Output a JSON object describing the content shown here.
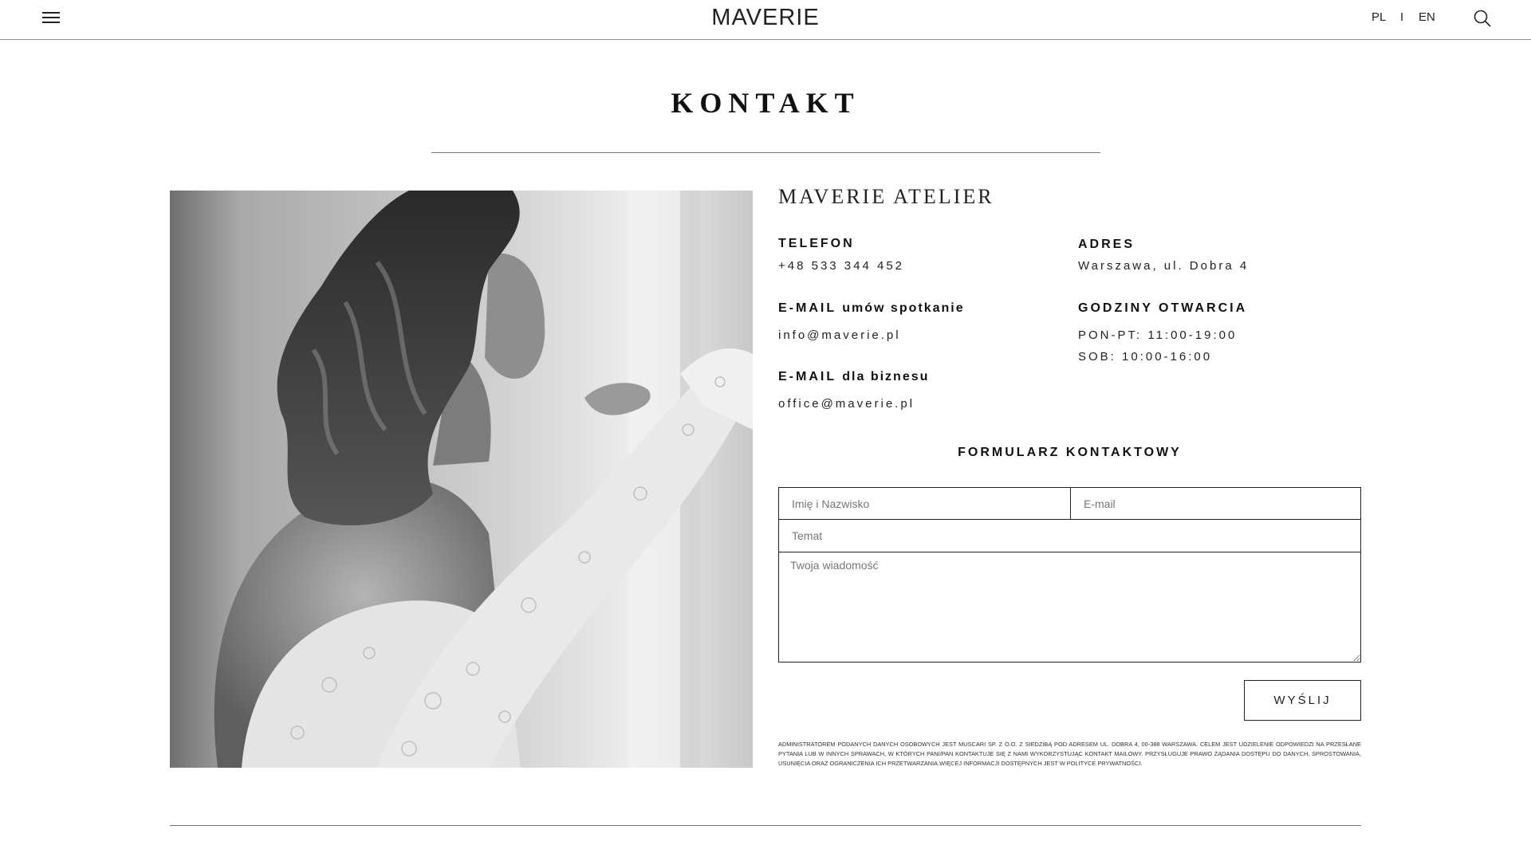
{
  "header": {
    "logo": "MAVERIE",
    "lang_pl": "PL",
    "lang_separator": "I",
    "lang_en": "EN"
  },
  "page": {
    "title": "KONTAKT"
  },
  "contact": {
    "atelier_title": "MAVERIE ATELIER",
    "phone_label": "TELEFON",
    "phone_value": "+48 533 344 452",
    "email_meeting_label": "E-MAIL",
    "email_meeting_sub": "umów spotkanie",
    "email_meeting_value": "info@maverie.pl",
    "email_business_label": "E-MAIL",
    "email_business_sub": "dla biznesu",
    "email_business_value": "office@maverie.pl",
    "address_label": "ADRES",
    "address_value": "Warszawa, ul. Dobra 4",
    "hours_label": "GODZINY OTWARCIA",
    "hours_weekdays": "PON-PT: 11:00-19:00",
    "hours_saturday": "SOB: 10:00-16:00"
  },
  "form": {
    "title": "FORMULARZ KONTAKTOWY",
    "name_placeholder": "Imię i Nazwisko",
    "email_placeholder": "E-mail",
    "subject_placeholder": "Temat",
    "message_placeholder": "Twoja wiadomość",
    "submit_label": "WYŚLIJ",
    "legal_text": "Administratorem podanych danych osobowych jest Muscari sp. z o.o. z siedzibą pod adresem ul. Dobra 4, 00-388 Warszawa. Celem jest udzielenie odpowiedzi na przesłane pytania lub w innych sprawach, w których Pani/Pan kontaktuje się z nami wykorzystując kontakt mailowy. Przysługuje prawo żądania dostępu do danych, sprostowania, usunięcia oraz ograniczenia ich przetwarzania.Więcej informacji dostępnych jest w polityce prywatności."
  },
  "icons": {
    "menu": "hamburger-menu-icon",
    "search": "search-icon"
  },
  "colors": {
    "text": "#111111",
    "background": "#ffffff",
    "rule": "#777777"
  }
}
